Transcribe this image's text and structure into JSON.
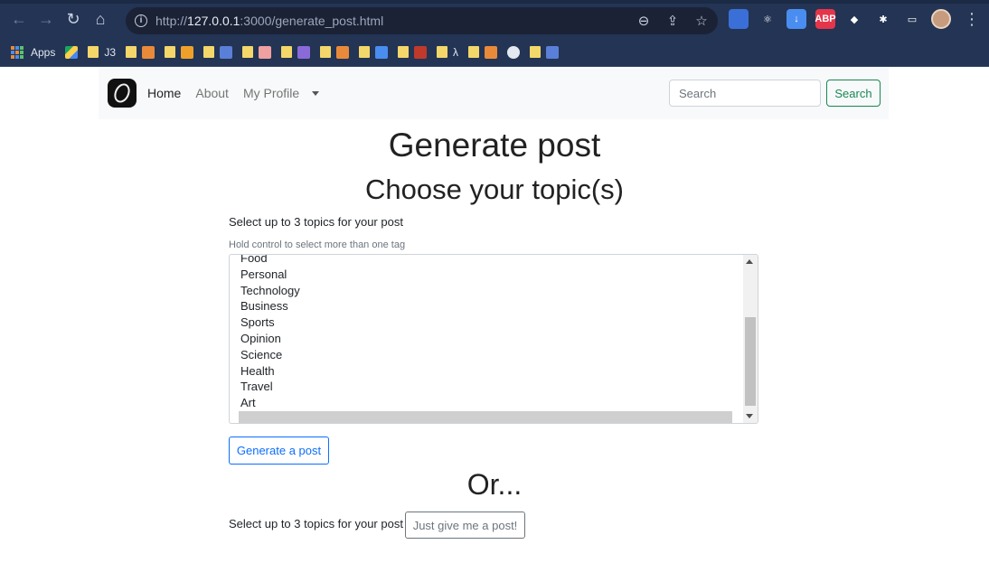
{
  "browser": {
    "url_prefix": "http://",
    "url_host": "127.0.0.1",
    "url_rest": ":3000/generate_post.html",
    "info_icon": "i",
    "bookmarks": [
      {
        "label": "Apps",
        "icon": "apps-grid-icon"
      },
      {
        "label": "",
        "icon": "drive-icon"
      },
      {
        "label": "J3",
        "icon": "folder-icon"
      },
      {
        "label": "",
        "icon": "folder-icon"
      },
      {
        "label": "",
        "icon": "folder-icon"
      },
      {
        "label": "",
        "icon": "folder-icon"
      },
      {
        "label": "",
        "icon": "folder-icon"
      },
      {
        "label": "",
        "icon": "folder-icon"
      },
      {
        "label": "",
        "icon": "folder-icon"
      },
      {
        "label": "",
        "icon": "folder-icon"
      },
      {
        "label": "",
        "icon": "folder-icon"
      },
      {
        "label": "λ",
        "icon": "folder-icon"
      },
      {
        "label": "",
        "icon": "folder-icon"
      },
      {
        "label": "",
        "icon": "github-icon"
      },
      {
        "label": "",
        "icon": "folder-icon"
      }
    ],
    "extensions": [
      {
        "name": "shield-extension-icon",
        "color": "#3b6fd8",
        "text": ""
      },
      {
        "name": "react-devtools-icon",
        "color": "#233454",
        "text": "⚛"
      },
      {
        "name": "download-extension-icon",
        "color": "#4a8df0",
        "text": "↓"
      },
      {
        "name": "adblock-plus-icon",
        "color": "#e5354a",
        "text": "ABP"
      },
      {
        "name": "colorpick-icon",
        "color": "#233454",
        "text": "◆"
      },
      {
        "name": "extensions-puzzle-icon",
        "color": "#233454",
        "text": "✱"
      },
      {
        "name": "side-panel-icon",
        "color": "#233454",
        "text": "▭"
      }
    ]
  },
  "navbar": {
    "home": "Home",
    "about": "About",
    "profile": "My Profile",
    "search_placeholder": "Search",
    "search_button": "Search"
  },
  "page": {
    "title": "Generate post",
    "subtitle": "Choose your topic(s)",
    "label": "Select up to 3 topics for your post",
    "help_text": "Hold control to select more than one tag",
    "topics": [
      "Food",
      "Personal",
      "Technology",
      "Business",
      "Sports",
      "Opinion",
      "Science",
      "Health",
      "Travel",
      "Art",
      ""
    ],
    "selected_index": 10,
    "generate_button": "Generate a post",
    "or_text": "Or...",
    "second_label": "Select up to 3 topics for your post",
    "give_button": "Just give me a post!"
  }
}
